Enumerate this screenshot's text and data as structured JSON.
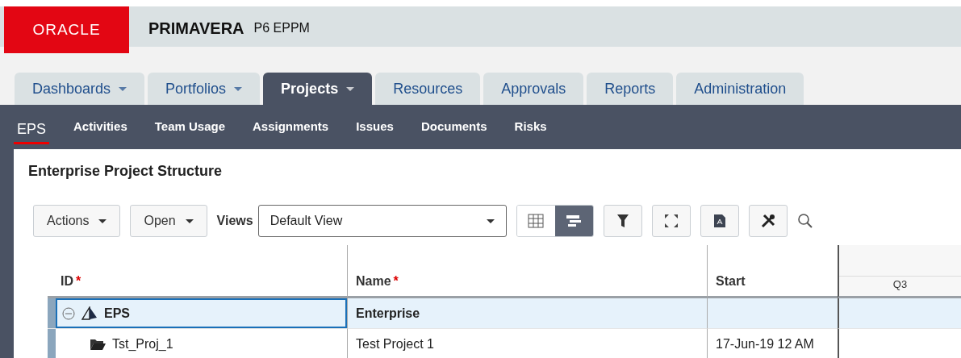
{
  "brand": {
    "logo": "ORACLE",
    "product": "PRIMAVERA",
    "edition": "P6 EPPM"
  },
  "tabs": [
    {
      "label": "Dashboards",
      "dropdown": true,
      "selected": false
    },
    {
      "label": "Portfolios",
      "dropdown": true,
      "selected": false
    },
    {
      "label": "Projects",
      "dropdown": true,
      "selected": true
    },
    {
      "label": "Resources",
      "dropdown": false,
      "selected": false
    },
    {
      "label": "Approvals",
      "dropdown": false,
      "selected": false
    },
    {
      "label": "Reports",
      "dropdown": false,
      "selected": false
    },
    {
      "label": "Administration",
      "dropdown": false,
      "selected": false
    }
  ],
  "subnav": [
    {
      "label": "EPS",
      "selected": true
    },
    {
      "label": "Activities",
      "selected": false
    },
    {
      "label": "Team Usage",
      "selected": false
    },
    {
      "label": "Assignments",
      "selected": false
    },
    {
      "label": "Issues",
      "selected": false
    },
    {
      "label": "Documents",
      "selected": false
    },
    {
      "label": "Risks",
      "selected": false
    }
  ],
  "page_title": "Enterprise Project Structure",
  "toolbar": {
    "menus": [
      "Actions",
      "Open"
    ],
    "views_label": "Views",
    "views_value": "Default View",
    "view_modes": [
      {
        "kind": "table",
        "selected": false
      },
      {
        "kind": "gantt",
        "selected": true
      }
    ]
  },
  "table": {
    "columns": [
      {
        "label": "ID",
        "required_mark": "*"
      },
      {
        "label": "Name",
        "required_mark": "*"
      },
      {
        "label": "Start"
      }
    ],
    "gantt_header": "Q3",
    "rows": [
      {
        "kind": "eps",
        "id": "EPS",
        "name": "Enterprise",
        "expanded": true,
        "selected": true,
        "children": [
          {
            "kind": "project",
            "id": "Tst_Proj_1",
            "name": "Test Project 1",
            "start": "17-Jun-19 12 AM",
            "selected": false
          }
        ]
      }
    ]
  }
}
